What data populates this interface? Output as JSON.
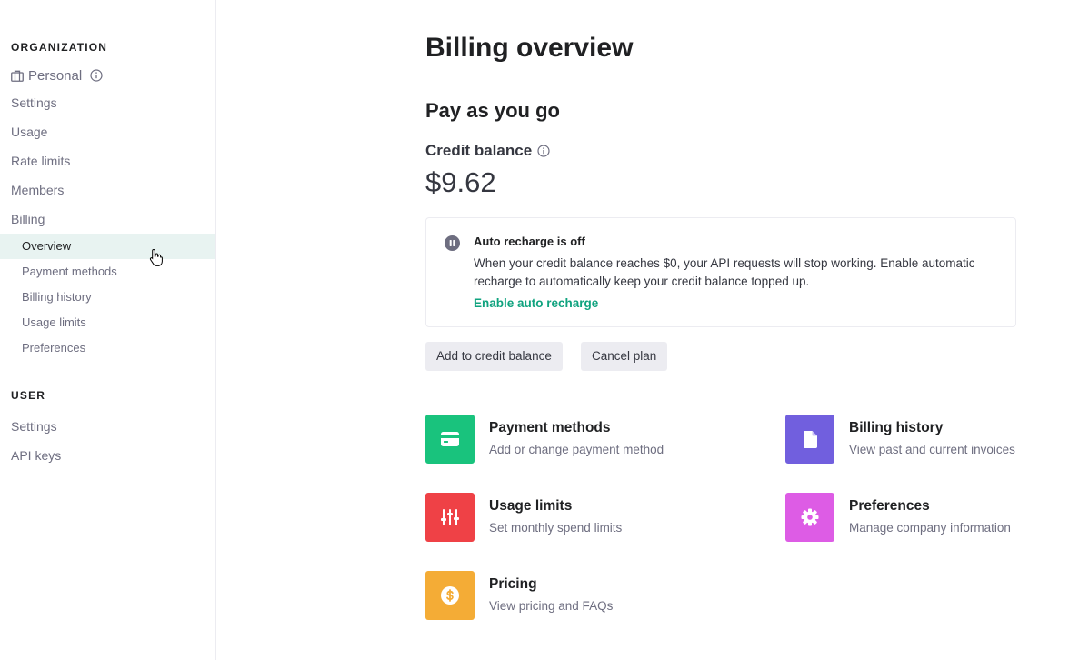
{
  "sidebar": {
    "org_section": "ORGANIZATION",
    "org_name": "Personal",
    "items": [
      {
        "label": "Settings"
      },
      {
        "label": "Usage"
      },
      {
        "label": "Rate limits"
      },
      {
        "label": "Members"
      },
      {
        "label": "Billing"
      }
    ],
    "billing_sub": [
      {
        "label": "Overview",
        "active": true
      },
      {
        "label": "Payment methods"
      },
      {
        "label": "Billing history"
      },
      {
        "label": "Usage limits"
      },
      {
        "label": "Preferences"
      }
    ],
    "user_section": "USER",
    "user_items": [
      {
        "label": "Settings"
      },
      {
        "label": "API keys"
      }
    ]
  },
  "main": {
    "title": "Billing overview",
    "plan": "Pay as you go",
    "credit_label": "Credit balance",
    "credit_amount": "$9.62",
    "notice": {
      "title": "Auto recharge is off",
      "body": "When your credit balance reaches $0, your API requests will stop working. Enable automatic recharge to automatically keep your credit balance topped up.",
      "link": "Enable auto recharge"
    },
    "buttons": {
      "add_credit": "Add to credit balance",
      "cancel_plan": "Cancel plan"
    },
    "cards": [
      {
        "title": "Payment methods",
        "desc": "Add or change payment method",
        "icon": "credit-card-icon",
        "color": "#19c37d"
      },
      {
        "title": "Billing history",
        "desc": "View past and current invoices",
        "icon": "document-icon",
        "color": "#715fde"
      },
      {
        "title": "Usage limits",
        "desc": "Set monthly spend limits",
        "icon": "sliders-icon",
        "color": "#ef4146"
      },
      {
        "title": "Preferences",
        "desc": "Manage company information",
        "icon": "gear-icon",
        "color": "#dd5ce5"
      },
      {
        "title": "Pricing",
        "desc": "View pricing and FAQs",
        "icon": "dollar-icon",
        "color": "#f4ac36"
      }
    ]
  },
  "colors": {
    "accent": "#10a37f",
    "active_bg": "#e8f3f1"
  }
}
